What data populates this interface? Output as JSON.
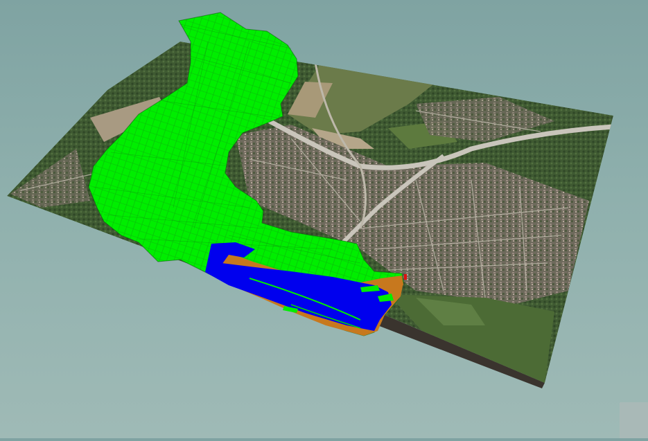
{
  "scene": {
    "background_top": "#7fa3a2",
    "background_bottom": "#9fbab6",
    "terrain": {
      "name": "orthophoto-terrain",
      "colors": {
        "vegetation": "#3f5e34",
        "field": "#6b7b4c",
        "bare_field": "#a89978",
        "urban": "#7a7466",
        "roads": "#b9b4a6",
        "highway": "#c9c5bb",
        "terrain_side": "#3a342e"
      }
    },
    "overlays": [
      {
        "name": "flood-zone-green",
        "color": "#00ee00",
        "outline": "#0d5e0d"
      },
      {
        "name": "river-water-blue",
        "color": "#0000ee"
      },
      {
        "name": "riverbank-orange",
        "color": "#c7781e"
      },
      {
        "name": "marker-red",
        "color": "#e01010"
      }
    ],
    "corner_widget_icon": "panel-tab-icon"
  }
}
